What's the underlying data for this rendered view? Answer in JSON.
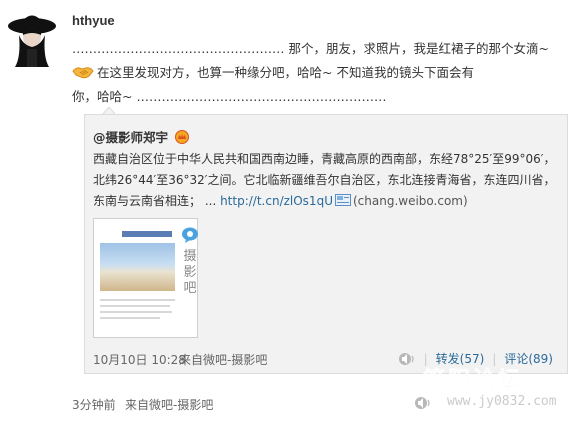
{
  "post": {
    "username": "hthyue",
    "line1": "…………………………………………… 那个，朋友，求照片，我是红裙子的那个女滴~",
    "line2": "在这里发现对方，也算一种缘分吧，哈哈~ 不知道我的镜头下面会有",
    "line3": "你，哈哈~ ……………………………………………………",
    "handshake_icon": "handshake-icon"
  },
  "repost": {
    "source_user": "@摄影师郑宇",
    "badge_icon": "crown-badge-icon",
    "text_line1": "西藏自治区位于中华人民共和国西南边睡，青藏高原的西南部，东经78°25′至99°06′，",
    "text_line2": "北纬26°44′至36°32′之间。它北临新疆维吾尔自治区，东北连接青海省，东连四川省，",
    "text_line3_a": "东南与云南省相连； ... ",
    "link": "http://t.cn/zlOs1qU",
    "link_domain": "(chang.weibo.com)",
    "thumb_badge_label": "摄影吧",
    "time": "10月10日 10:28",
    "via": "来自微吧-摄影吧",
    "repost_label": "转发(57)",
    "comment_label": "评论(89)",
    "separator": "|"
  },
  "footer": {
    "time": "3分钟前",
    "via": "来自微吧-摄影吧"
  },
  "watermark": {
    "title": "简阳论坛",
    "url": "www.jy0832.com"
  },
  "colors": {
    "link": "#2a6a9a",
    "repost_bg": "#f2f2f2",
    "text": "#333333"
  }
}
